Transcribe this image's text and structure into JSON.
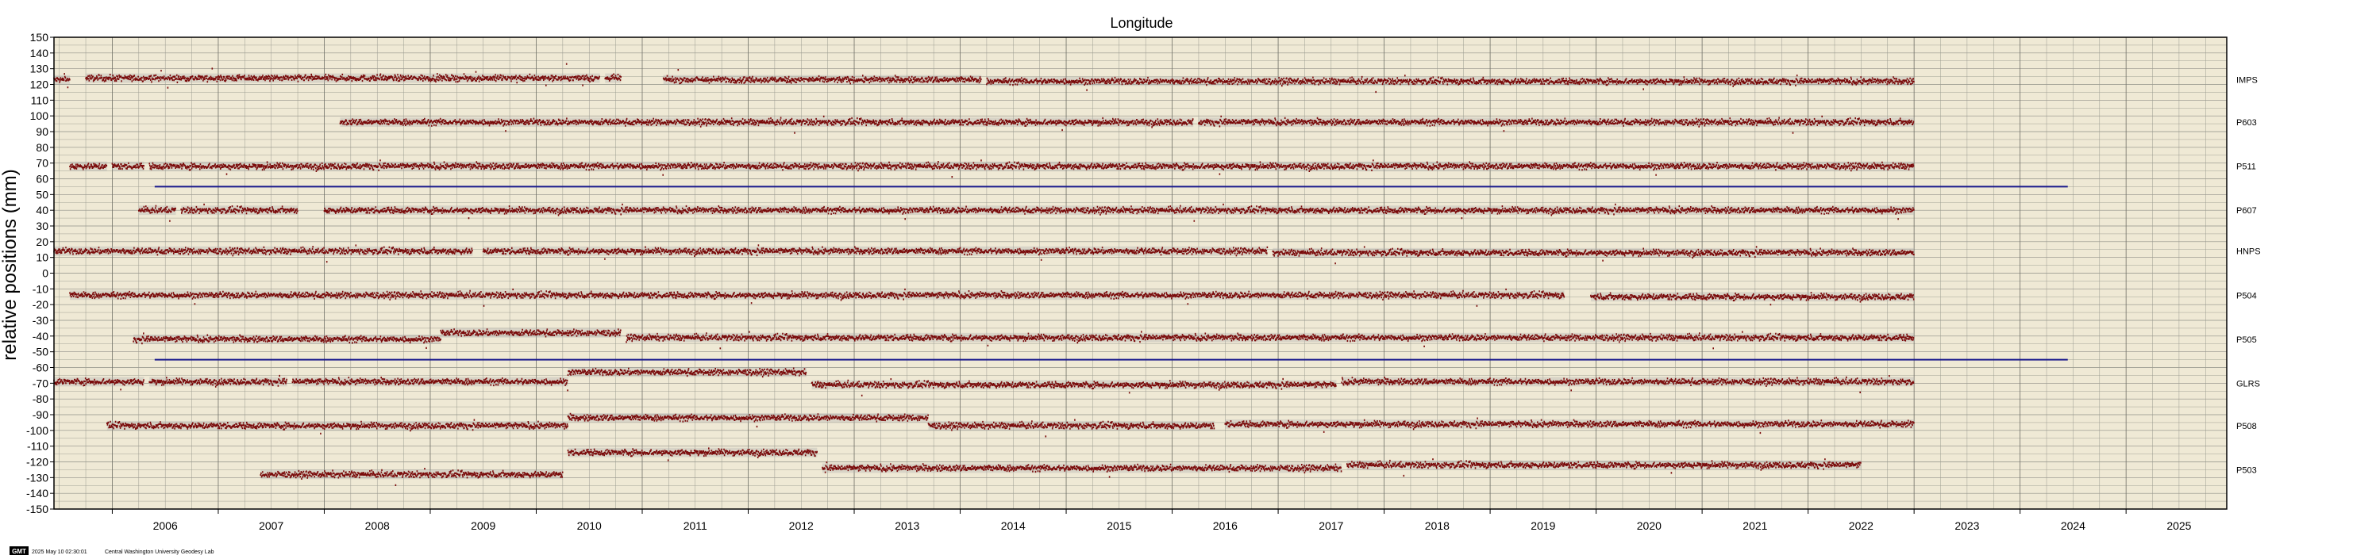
{
  "chart_data": {
    "type": "scatter",
    "title": "Longitude",
    "ylabel": "relative positions (mm)",
    "xlabel": "",
    "xlim": [
      2005.45,
      2025.95
    ],
    "ylim": [
      -150,
      150
    ],
    "y_ticks": [
      150,
      140,
      130,
      120,
      110,
      100,
      90,
      80,
      70,
      60,
      50,
      40,
      30,
      20,
      10,
      0,
      -10,
      -20,
      -30,
      -40,
      -50,
      -60,
      -70,
      -80,
      -90,
      -100,
      -110,
      -120,
      -130,
      -140,
      -150
    ],
    "x_tick_labels": [
      "2006",
      "2007",
      "2008",
      "2009",
      "2010",
      "2011",
      "2012",
      "2013",
      "2014",
      "2015",
      "2016",
      "2017",
      "2018",
      "2019",
      "2020",
      "2021",
      "2022",
      "2023",
      "2024",
      "2025"
    ],
    "grid": true,
    "marker_color": "#7a0a0a",
    "errorbar_color": "#b0b0b0",
    "plot_background": "#efe9d5",
    "reference_line_color": "#1a1a8c",
    "reference_lines": [
      {
        "y": 55,
        "x_start": 2006.4,
        "x_end": 2024.45
      },
      {
        "y": -55,
        "x_start": 2006.4,
        "x_end": 2024.45
      }
    ],
    "series": [
      {
        "name": "IMPS",
        "offset": 123,
        "segments": [
          [
            2005.45,
            2005.6,
            123
          ],
          [
            2005.75,
            2010.6,
            124
          ],
          [
            2010.65,
            2010.8,
            124
          ],
          [
            2011.2,
            2014.2,
            123
          ],
          [
            2014.25,
            2023.0,
            122
          ]
        ]
      },
      {
        "name": "P603",
        "offset": 96,
        "segments": [
          [
            2008.15,
            2016.2,
            96
          ],
          [
            2016.25,
            2023.0,
            96
          ]
        ]
      },
      {
        "name": "P511",
        "offset": 68,
        "segments": [
          [
            2005.6,
            2005.95,
            68
          ],
          [
            2006.0,
            2006.3,
            68
          ],
          [
            2006.35,
            2023.0,
            68
          ]
        ]
      },
      {
        "name": "P607",
        "offset": 40,
        "segments": [
          [
            2006.25,
            2006.6,
            40
          ],
          [
            2006.65,
            2007.75,
            40
          ],
          [
            2008.0,
            2023.0,
            40
          ]
        ]
      },
      {
        "name": "HNPS",
        "offset": 14,
        "segments": [
          [
            2005.45,
            2009.4,
            14
          ],
          [
            2009.5,
            2016.9,
            14
          ],
          [
            2016.95,
            2023.0,
            13
          ]
        ]
      },
      {
        "name": "P504",
        "offset": -14,
        "segments": [
          [
            2005.6,
            2019.7,
            -14
          ],
          [
            2019.95,
            2023.0,
            -15
          ]
        ]
      },
      {
        "name": "P505",
        "offset": -42,
        "segments": [
          [
            2006.2,
            2009.1,
            -42
          ],
          [
            2009.1,
            2010.8,
            -38
          ],
          [
            2010.85,
            2023.0,
            -41
          ]
        ]
      },
      {
        "name": "GLRS",
        "offset": -70,
        "segments": [
          [
            2005.45,
            2006.3,
            -69
          ],
          [
            2006.35,
            2007.65,
            -69
          ],
          [
            2007.7,
            2010.3,
            -69
          ],
          [
            2010.3,
            2012.55,
            -63
          ],
          [
            2012.6,
            2017.55,
            -71
          ],
          [
            2017.6,
            2023.0,
            -69
          ]
        ]
      },
      {
        "name": "P508",
        "offset": -97,
        "segments": [
          [
            2005.95,
            2010.3,
            -97
          ],
          [
            2010.3,
            2013.7,
            -92
          ],
          [
            2013.7,
            2016.4,
            -97
          ],
          [
            2016.5,
            2023.0,
            -96
          ]
        ]
      },
      {
        "name": "P503",
        "offset": -125,
        "segments": [
          [
            2007.4,
            2010.25,
            -128
          ],
          [
            2010.3,
            2012.65,
            -114
          ],
          [
            2012.7,
            2017.6,
            -124
          ],
          [
            2017.65,
            2022.5,
            -122
          ]
        ]
      }
    ]
  },
  "footer": {
    "gmt_badge": "GMT",
    "timestamp": "2025 May 10 02:30:01",
    "credit": "Central Washington University Geodesy Lab"
  }
}
